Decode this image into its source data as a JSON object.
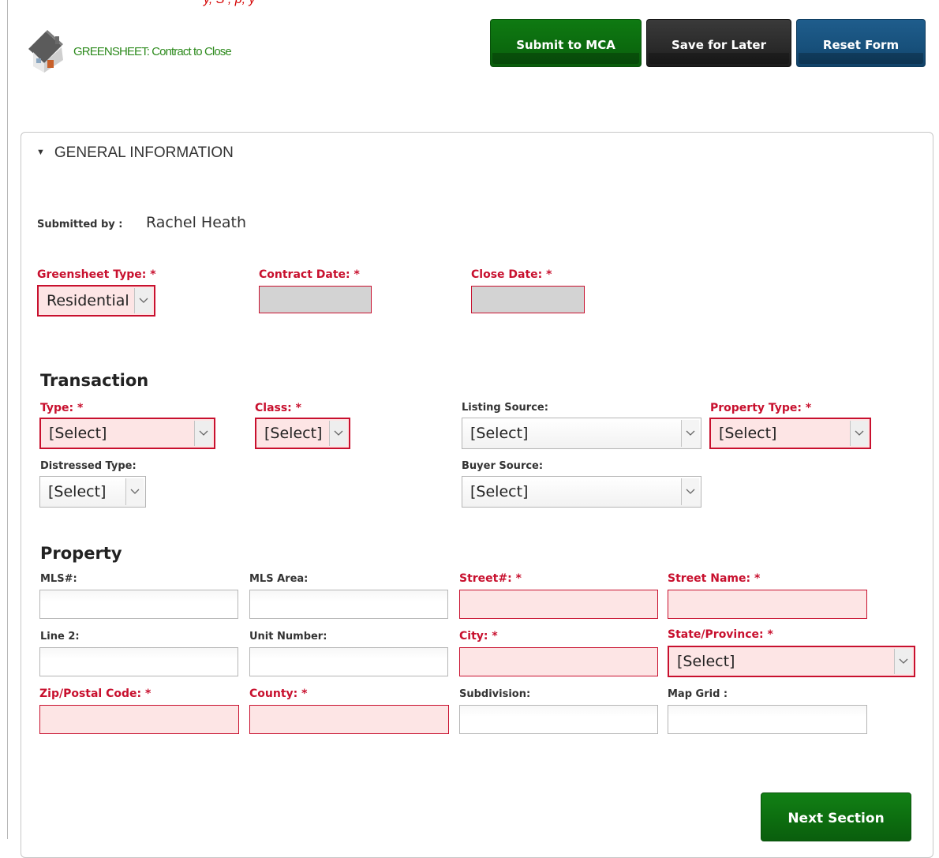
{
  "top_note": "y, S , p, y",
  "brand": {
    "title": "GREENSHEET: Contract to Close"
  },
  "toolbar": {
    "submit_label": "Submit to MCA",
    "save_label": "Save for Later",
    "reset_label": "Reset Form"
  },
  "section": {
    "title": "GENERAL INFORMATION"
  },
  "general": {
    "submitted_label": "Submitted by :",
    "submitted_value": "Rachel Heath",
    "greensheet_type_label": "Greensheet Type: *",
    "greensheet_type_value": "Residential",
    "contract_date_label": "Contract Date: *",
    "close_date_label": "Close Date: *"
  },
  "transaction": {
    "heading": "Transaction",
    "type_label": "Type: *",
    "type_value": "[Select]",
    "class_label": "Class: *",
    "class_value": "[Select]",
    "listing_source_label": "Listing Source:",
    "listing_source_value": "[Select]",
    "property_type_label": "Property Type: *",
    "property_type_value": "[Select]",
    "distressed_label": "Distressed Type:",
    "distressed_value": "[Select]",
    "buyer_source_label": "Buyer Source:",
    "buyer_source_value": "[Select]"
  },
  "property": {
    "heading": "Property",
    "mls_label": "MLS#:",
    "mls_area_label": "MLS Area:",
    "street_no_label": "Street#: *",
    "street_name_label": "Street Name: *",
    "line2_label": "Line 2:",
    "unit_label": "Unit Number:",
    "city_label": "City: *",
    "state_label": "State/Province: *",
    "state_value": "[Select]",
    "zip_label": "Zip/Postal Code: *",
    "county_label": "County: *",
    "subdivision_label": "Subdivision:",
    "map_grid_label": "Map Grid :"
  },
  "footer": {
    "next_label": "Next Section"
  },
  "colors": {
    "required": "#c8102e",
    "required_bg": "#fde5e5",
    "brand_green": "#2e8b1e"
  }
}
